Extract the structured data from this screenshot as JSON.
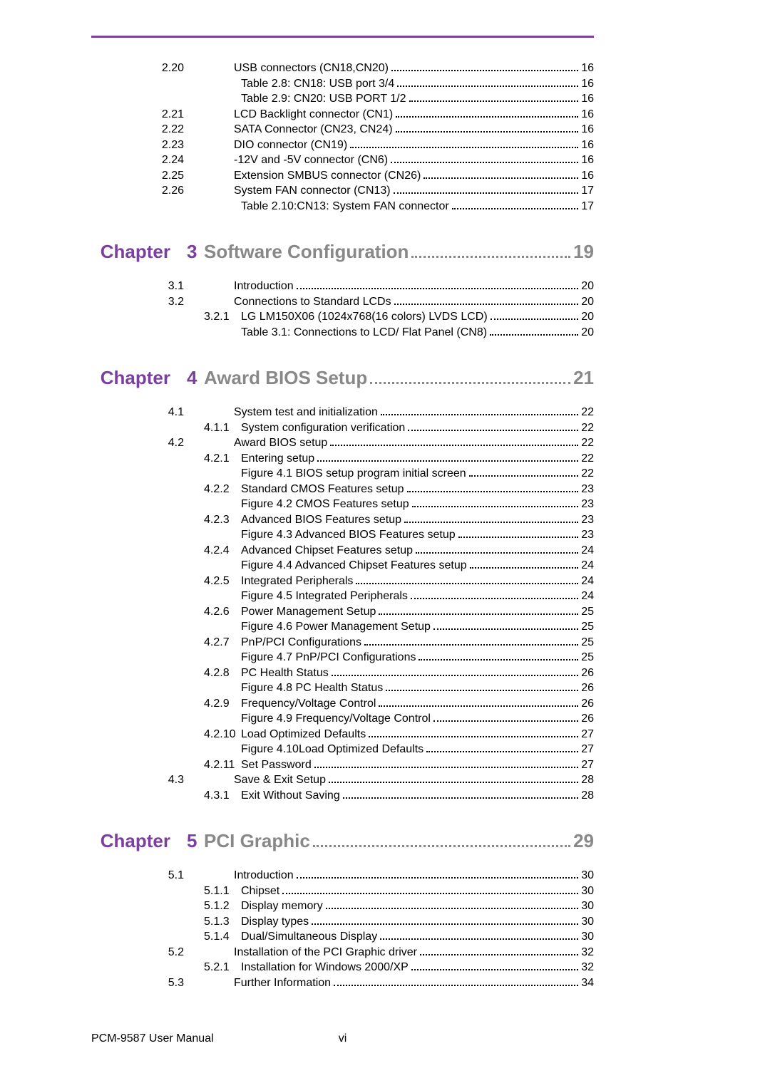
{
  "sections": [
    {
      "type": "sec",
      "num": "2.20",
      "label": "USB connectors (CN18,CN20)",
      "page": "16"
    },
    {
      "type": "sub2",
      "label": "Table 2.8:  CN18:  USB port 3/4",
      "page": "16"
    },
    {
      "type": "sub2",
      "label": "Table 2.9:  CN20: USB PORT 1/2",
      "page": "16"
    },
    {
      "type": "sec",
      "num": "2.21",
      "label": "LCD Backlight connector (CN1)",
      "page": "16"
    },
    {
      "type": "sec",
      "num": "2.22",
      "label": "SATA Connector (CN23, CN24)",
      "page": "16"
    },
    {
      "type": "sec",
      "num": "2.23",
      "label": "DIO connector (CN19)",
      "page": "16"
    },
    {
      "type": "sec",
      "num": "2.24",
      "label": "-12V and -5V connector (CN6)",
      "page": "16"
    },
    {
      "type": "sec",
      "num": "2.25",
      "label": "Extension SMBUS connector (CN26)",
      "page": "16"
    },
    {
      "type": "sec",
      "num": "2.26",
      "label": "System FAN connector (CN13)",
      "page": "17"
    },
    {
      "type": "sub2",
      "label": "Table 2.10:CN13:  System FAN connector",
      "page": "17"
    },
    {
      "type": "chapter",
      "num": "3",
      "label": "Software Configuration",
      "page": "19"
    },
    {
      "type": "sec",
      "num": "3.1",
      "label": "Introduction",
      "page": "20"
    },
    {
      "type": "sec",
      "num": "3.2",
      "label": "Connections to Standard LCDs",
      "page": "20"
    },
    {
      "type": "sub",
      "subnum": "3.2.1",
      "label": "LG LM150X06 (1024x768(16 colors) LVDS LCD)",
      "page": "20"
    },
    {
      "type": "sub2",
      "label": "Table 3.1:  Connections to LCD/ Flat Panel (CN8)",
      "page": "20"
    },
    {
      "type": "chapter",
      "num": "4",
      "label": "Award BIOS Setup",
      "page": "21"
    },
    {
      "type": "sec",
      "num": "4.1",
      "label": "System test and initialization",
      "page": "22"
    },
    {
      "type": "sub",
      "subnum": "4.1.1",
      "label": "System configuration verification",
      "page": "22"
    },
    {
      "type": "sec",
      "num": "4.2",
      "label": "Award BIOS setup",
      "page": "22"
    },
    {
      "type": "sub",
      "subnum": "4.2.1",
      "label": "Entering setup",
      "page": "22"
    },
    {
      "type": "sub2",
      "label": "Figure 4.1  BIOS setup program initial screen",
      "page": "22"
    },
    {
      "type": "sub",
      "subnum": "4.2.2",
      "label": "Standard CMOS Features setup",
      "page": "23"
    },
    {
      "type": "sub2",
      "label": "Figure 4.2  CMOS Features setup",
      "page": "23"
    },
    {
      "type": "sub",
      "subnum": "4.2.3",
      "label": "Advanced BIOS Features setup",
      "page": "23"
    },
    {
      "type": "sub2",
      "label": "Figure 4.3  Advanced BIOS Features setup",
      "page": "23"
    },
    {
      "type": "sub",
      "subnum": "4.2.4",
      "label": "Advanced Chipset Features setup",
      "page": "24"
    },
    {
      "type": "sub2",
      "label": "Figure 4.4  Advanced Chipset Features setup",
      "page": "24"
    },
    {
      "type": "sub",
      "subnum": "4.2.5",
      "label": "Integrated Peripherals",
      "page": "24"
    },
    {
      "type": "sub2",
      "label": "Figure 4.5  Integrated Peripherals",
      "page": "24"
    },
    {
      "type": "sub",
      "subnum": "4.2.6",
      "label": "Power Management Setup",
      "page": "25"
    },
    {
      "type": "sub2",
      "label": "Figure 4.6  Power Management Setup",
      "page": "25"
    },
    {
      "type": "sub",
      "subnum": "4.2.7",
      "label": "PnP/PCI Configurations",
      "page": "25"
    },
    {
      "type": "sub2",
      "label": "Figure 4.7  PnP/PCI Configurations",
      "page": "25"
    },
    {
      "type": "sub",
      "subnum": "4.2.8",
      "label": "PC Health Status",
      "page": "26"
    },
    {
      "type": "sub2",
      "label": "Figure 4.8  PC Health Status",
      "page": "26"
    },
    {
      "type": "sub",
      "subnum": "4.2.9",
      "label": "Frequency/Voltage Control",
      "page": "26"
    },
    {
      "type": "sub2",
      "label": "Figure 4.9  Frequency/Voltage Control",
      "page": "26"
    },
    {
      "type": "sub",
      "subnum": "4.2.10",
      "label": "Load Optimized Defaults",
      "page": "27"
    },
    {
      "type": "sub2",
      "label": "Figure 4.10Load Optimized Defaults",
      "page": "27"
    },
    {
      "type": "sub",
      "subnum": "4.2.11",
      "label": "Set Password",
      "page": "27"
    },
    {
      "type": "sec",
      "num": "4.3",
      "label": "Save & Exit Setup",
      "page": "28"
    },
    {
      "type": "sub",
      "subnum": "4.3.1",
      "label": "Exit Without Saving",
      "page": "28"
    },
    {
      "type": "chapter",
      "num": "5",
      "label": "PCI Graphic",
      "page": "29"
    },
    {
      "type": "sec",
      "num": "5.1",
      "label": "Introduction",
      "page": "30"
    },
    {
      "type": "sub",
      "subnum": "5.1.1",
      "label": "Chipset",
      "page": "30"
    },
    {
      "type": "sub",
      "subnum": "5.1.2",
      "label": "Display memory",
      "page": "30"
    },
    {
      "type": "sub",
      "subnum": "5.1.3",
      "label": "Display types",
      "page": "30"
    },
    {
      "type": "sub",
      "subnum": "5.1.4",
      "label": "Dual/Simultaneous Display",
      "page": "30"
    },
    {
      "type": "sec",
      "num": "5.2",
      "label": "Installation of the PCI Graphic driver",
      "page": "32"
    },
    {
      "type": "sub",
      "subnum": "5.2.1",
      "label": "Installation for Windows 2000/XP",
      "page": "32"
    },
    {
      "type": "sec",
      "num": "5.3",
      "label": "Further Information",
      "page": "34"
    }
  ],
  "chapter_word": "Chapter",
  "footer": {
    "left": "PCM-9587 User Manual",
    "center": "vi"
  }
}
